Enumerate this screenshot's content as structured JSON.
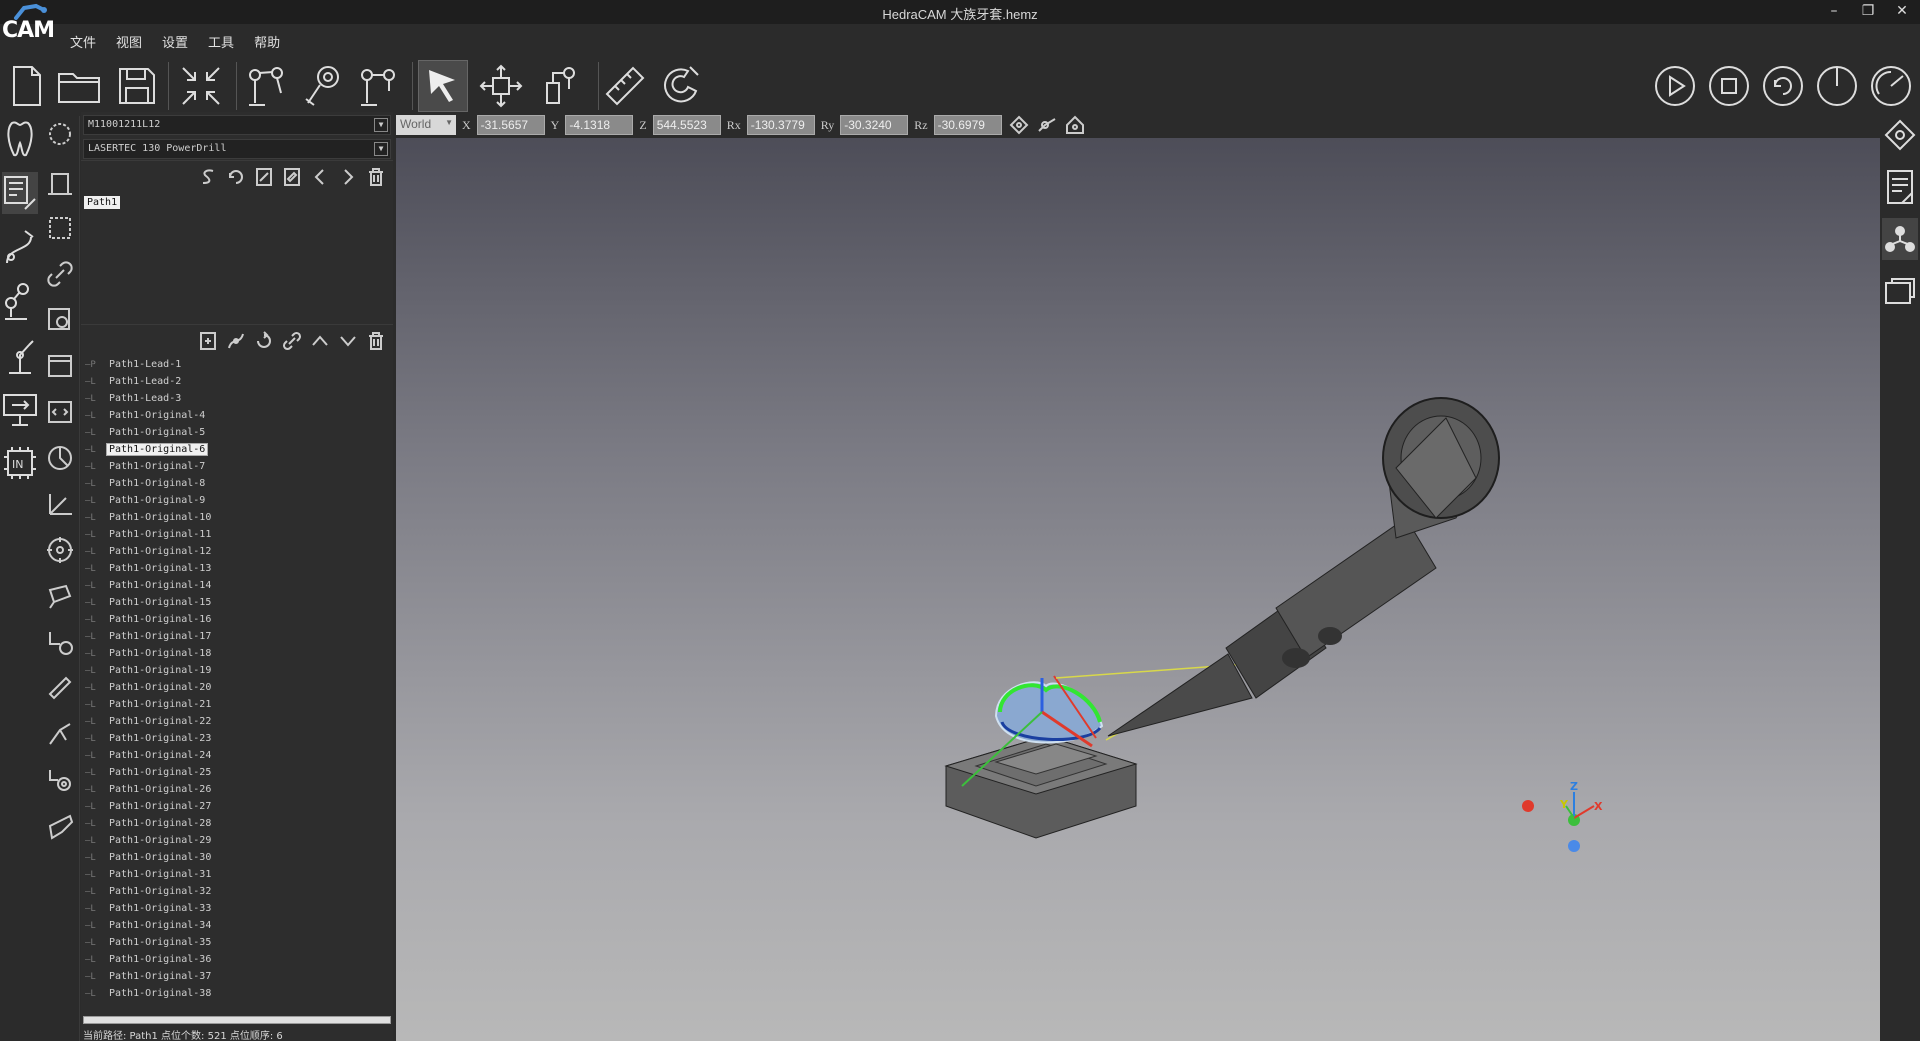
{
  "app": {
    "title": "HedraCAM  大族牙套.hemz",
    "logo_text": "CAM"
  },
  "window_controls": {
    "minimize": "–",
    "restore": "❐",
    "close": "✕"
  },
  "menu": [
    "文件",
    "视图",
    "设置",
    "工具",
    "帮助"
  ],
  "toolbar": {
    "left_icons": [
      "new-file-icon",
      "open-folder-icon",
      "save-icon",
      "fit-view-icon",
      "robot-arm-icon",
      "robot-tool-icon",
      "robot-config-icon",
      "select-cursor-icon",
      "move-icon",
      "robot-teach-icon",
      "ruler-icon",
      "magnet-icon"
    ],
    "right_icons": [
      "play-icon",
      "stop-icon",
      "reset-icon",
      "timer-icon",
      "speed-icon"
    ]
  },
  "left_panel": {
    "program_combo": "M11001211L12",
    "machine_combo": "LASERTEC 130 PowerDrill",
    "path_tools": [
      "s-curve-icon",
      "loop-icon",
      "add-path-icon",
      "edit-path-icon",
      "prev-icon",
      "next-icon",
      "delete-icon"
    ],
    "paths": [
      "Path1"
    ],
    "point_tools": [
      "new-point-icon",
      "curve-point-icon",
      "rotate-point-icon",
      "link-point-icon",
      "move-up-icon",
      "move-down-icon",
      "delete-point-icon"
    ],
    "tree_items": [
      {
        "prefix": "—P",
        "label": "Path1-Lead-1"
      },
      {
        "prefix": "—L",
        "label": "Path1-Lead-2"
      },
      {
        "prefix": "—L",
        "label": "Path1-Lead-3"
      },
      {
        "prefix": "—L",
        "label": "Path1-Original-4"
      },
      {
        "prefix": "—L",
        "label": "Path1-Original-5"
      },
      {
        "prefix": "—L",
        "label": "Path1-Original-6",
        "selected": true
      },
      {
        "prefix": "—L",
        "label": "Path1-Original-7"
      },
      {
        "prefix": "—L",
        "label": "Path1-Original-8"
      },
      {
        "prefix": "—L",
        "label": "Path1-Original-9"
      },
      {
        "prefix": "—L",
        "label": "Path1-Original-10"
      },
      {
        "prefix": "—L",
        "label": "Path1-Original-11"
      },
      {
        "prefix": "—L",
        "label": "Path1-Original-12"
      },
      {
        "prefix": "—L",
        "label": "Path1-Original-13"
      },
      {
        "prefix": "—L",
        "label": "Path1-Original-14"
      },
      {
        "prefix": "—L",
        "label": "Path1-Original-15"
      },
      {
        "prefix": "—L",
        "label": "Path1-Original-16"
      },
      {
        "prefix": "—L",
        "label": "Path1-Original-17"
      },
      {
        "prefix": "—L",
        "label": "Path1-Original-18"
      },
      {
        "prefix": "—L",
        "label": "Path1-Original-19"
      },
      {
        "prefix": "—L",
        "label": "Path1-Original-20"
      },
      {
        "prefix": "—L",
        "label": "Path1-Original-21"
      },
      {
        "prefix": "—L",
        "label": "Path1-Original-22"
      },
      {
        "prefix": "—L",
        "label": "Path1-Original-23"
      },
      {
        "prefix": "—L",
        "label": "Path1-Original-24"
      },
      {
        "prefix": "—L",
        "label": "Path1-Original-25"
      },
      {
        "prefix": "—L",
        "label": "Path1-Original-26"
      },
      {
        "prefix": "—L",
        "label": "Path1-Original-27"
      },
      {
        "prefix": "—L",
        "label": "Path1-Original-28"
      },
      {
        "prefix": "—L",
        "label": "Path1-Original-29"
      },
      {
        "prefix": "—L",
        "label": "Path1-Original-30"
      },
      {
        "prefix": "—L",
        "label": "Path1-Original-31"
      },
      {
        "prefix": "—L",
        "label": "Path1-Original-32"
      },
      {
        "prefix": "—L",
        "label": "Path1-Original-33"
      },
      {
        "prefix": "—L",
        "label": "Path1-Original-34"
      },
      {
        "prefix": "—L",
        "label": "Path1-Original-35"
      },
      {
        "prefix": "—L",
        "label": "Path1-Original-36"
      },
      {
        "prefix": "—L",
        "label": "Path1-Original-37"
      },
      {
        "prefix": "—L",
        "label": "Path1-Original-38"
      }
    ],
    "status": "当前路径: Path1   点位个数: 521   点位顺序: 6"
  },
  "coords": {
    "frame": "World",
    "x_label": "X",
    "x": "-31.5657",
    "y_label": "Y",
    "y": "-4.1318",
    "z_label": "Z",
    "z": "544.5523",
    "rx_label": "Rx",
    "rx": "-130.3779",
    "ry_label": "Ry",
    "ry": "-30.3240",
    "rz_label": "Rz",
    "rz": "-30.6979"
  },
  "axis_triad": {
    "x": "X",
    "y": "Y",
    "z": "Z"
  },
  "colors": {
    "axis_x": "#e03a2c",
    "axis_y": "#3cbf3c",
    "axis_z": "#2c7fe0",
    "toolpath": "#32e632"
  }
}
